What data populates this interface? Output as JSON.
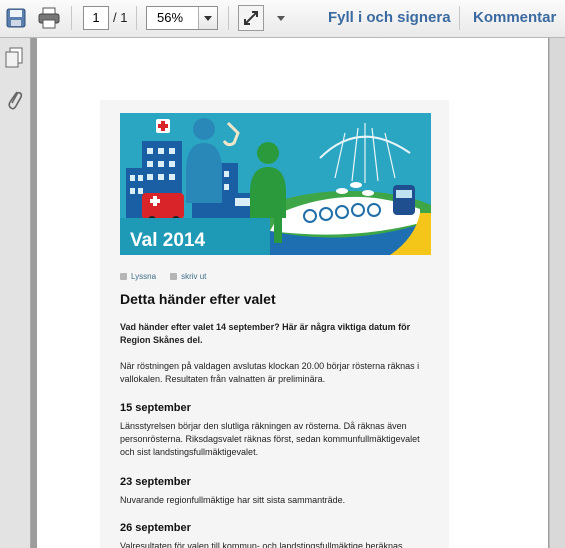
{
  "toolbar": {
    "page_current": "1",
    "page_total": "/ 1",
    "zoom": "56%",
    "fill_sign": "Fyll i och signera",
    "comment": "Kommentar"
  },
  "document": {
    "hero_text": "Val 2014",
    "tool_listen": "Lyssna",
    "tool_print": "skriv ut",
    "title": "Detta händer efter valet",
    "intro": "Vad händer efter valet 14 september? Här är några viktiga datum för Region Skånes del.",
    "para1": "När röstningen på valdagen avslutas klockan 20.00 börjar rösterna räknas i vallokalen. Resultaten från valnatten är preliminära.",
    "sections": [
      {
        "date": "15 september",
        "text": "Länsstyrelsen börjar den slutliga räkningen av rösterna. Då räknas även personrösterna. Riksdagsvalet räknas först, sedan kommunfullmäktigevalet och sist landstingsfullmäktigevalet."
      },
      {
        "date": "23 september",
        "text": "Nuvarande regionfullmäktige har sitt sista sammanträde."
      },
      {
        "date": "26 september",
        "text": "Valresultaten för valen till kommun- och landstingsfullmäktige beräknas"
      }
    ]
  }
}
